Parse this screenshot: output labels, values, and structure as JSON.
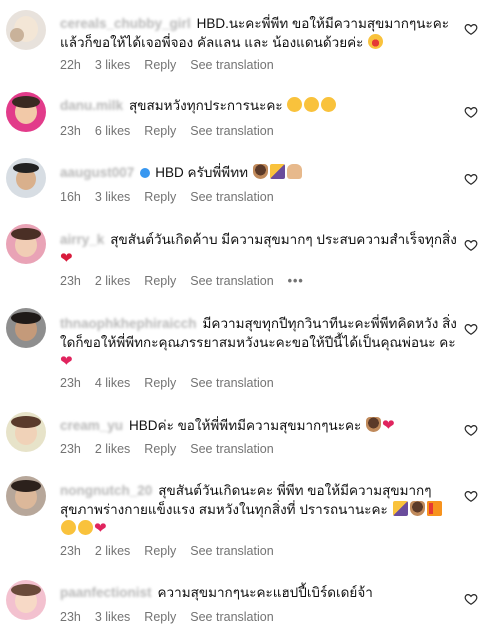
{
  "comments": [
    {
      "username": "cereals_chubby_girl",
      "text": "HBD.นะคะพี่พีท ขอให้มีความสุขมากๆนะคะ แล้วก็ขอให้ได้เจอพี่จอง คัลแลน และ น้องแดนด้วยค่ะ",
      "time": "22h",
      "likes": "3 likes",
      "reply": "Reply",
      "translate": "See translation"
    },
    {
      "username": "danu.milk",
      "text": "สุขสมหวังทุกประการนะคะ",
      "time": "23h",
      "likes": "6 likes",
      "reply": "Reply",
      "translate": "See translation"
    },
    {
      "username": "aaugust007",
      "text": "HBD ครับพี่พีทท",
      "time": "16h",
      "likes": "3 likes",
      "reply": "Reply",
      "translate": "See translation"
    },
    {
      "username": "airry_k",
      "text": "สุขสันต์วันเกิดค้าบ มีความสุขมากๆ ประสบความสำเร็จทุกสิ่ง",
      "time": "23h",
      "likes": "2 likes",
      "reply": "Reply",
      "translate": "See translation",
      "more": "•••"
    },
    {
      "username": "thnaophkhephiraicch",
      "text": "มีความสุขทุกปีทุกวินาทีนะคะพี่พีทคิดหวัง สิ่งใดก็ขอให้พี่พีทกะคุณภรรยาสมหวังนะคะขอให้ปีนี้ได้เป็นคุณพ่อนะ คะ",
      "time": "23h",
      "likes": "4 likes",
      "reply": "Reply",
      "translate": "See translation"
    },
    {
      "username": "cream_yu",
      "text": "HBDค่ะ ขอให้พี่พีทมีความสุขมากๆนะคะ",
      "time": "23h",
      "likes": "2 likes",
      "reply": "Reply",
      "translate": "See translation"
    },
    {
      "username": "nongnutch_20",
      "text": "สุขสันต์วันเกิดนะคะ พี่พีท ขอให้มีความสุขมากๆ สุขภาพร่างกายแข็งแรง สมหวังในทุกสิ่งที่ ปรารถนานะคะ",
      "time": "23h",
      "likes": "2 likes",
      "reply": "Reply",
      "translate": "See translation"
    },
    {
      "username": "paanfectionist",
      "text": "ความสุขมากๆนะคะแฮปปี้เบิร์ดเดย์จ้า",
      "time": "23h",
      "likes": "3 likes",
      "reply": "Reply",
      "translate": "See translation"
    }
  ],
  "icons": {
    "like": "heart-outline-icon",
    "verified": "verified-badge-icon"
  },
  "colors": {
    "meta": "#737373",
    "verified": "#3897f0",
    "heart": "#e0245e"
  }
}
